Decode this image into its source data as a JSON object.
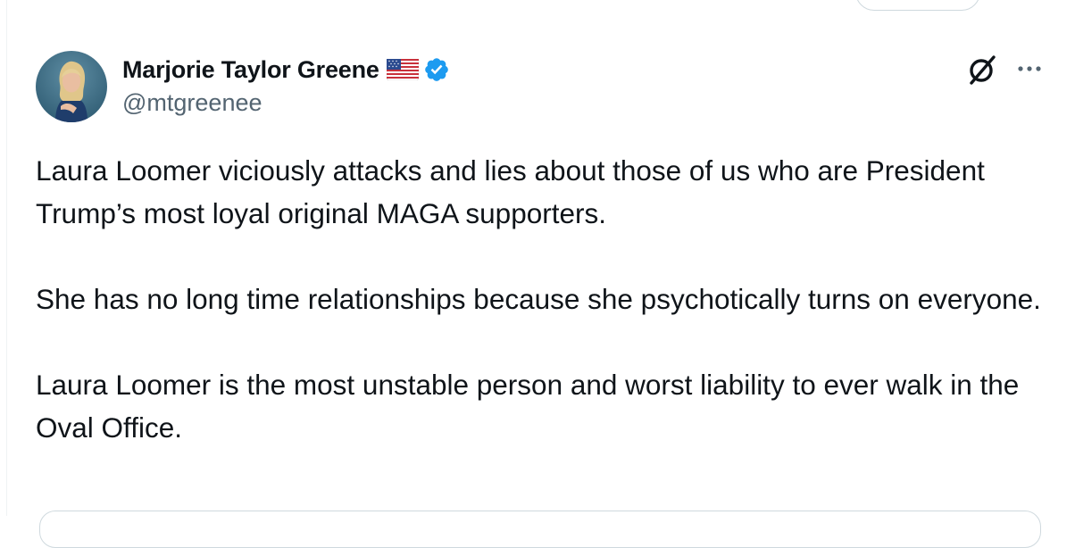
{
  "author": {
    "display_name": "Marjorie Taylor Greene",
    "handle": "@mtgreenee",
    "flag_icon": "us-flag-icon",
    "verified_icon": "verified-badge-icon",
    "verified_color": "#1d9bf0"
  },
  "actions": {
    "grok_icon": "grok-icon",
    "more_icon": "more-options-icon"
  },
  "tweet": {
    "paragraphs": [
      "Laura Loomer viciously attacks and lies about those of us who are President Trump’s most loyal original MAGA supporters.",
      "She has no long time relationships because she psychotically turns on everyone.",
      "Laura Loomer is the most unstable person and worst liability to ever walk in the Oval Office."
    ]
  },
  "colors": {
    "text_primary": "#0f1419",
    "text_secondary": "#536471",
    "border": "#cfd9de"
  }
}
